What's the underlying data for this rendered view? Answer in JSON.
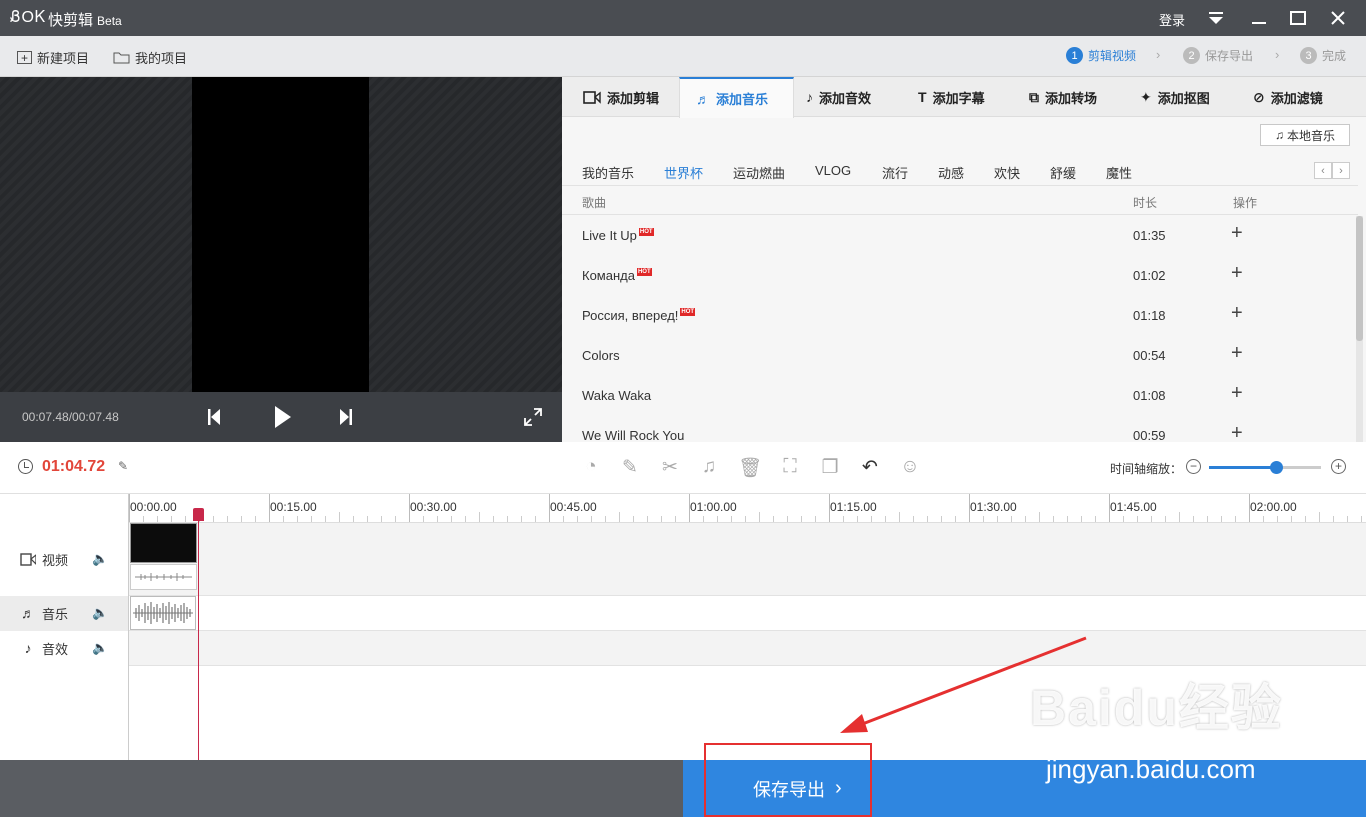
{
  "app": {
    "logo": "ᏰOᏦ",
    "name": "快剪辑",
    "edition": "Beta"
  },
  "titlebar": {
    "login": "登录"
  },
  "toolbar": {
    "new_project": "新建项目",
    "my_projects": "我的项目",
    "steps": [
      {
        "num": "1",
        "label": "剪辑视频"
      },
      {
        "num": "2",
        "label": "保存导出"
      },
      {
        "num": "3",
        "label": "完成"
      }
    ]
  },
  "player": {
    "time": "00:07.48/00:07.48"
  },
  "tabs": [
    {
      "label": "添加剪辑",
      "icon": "video-camera-icon"
    },
    {
      "label": "添加音乐",
      "icon": "music-note-icon"
    },
    {
      "label": "添加音效",
      "icon": "sound-effect-icon"
    },
    {
      "label": "添加字幕",
      "icon": "text-icon"
    },
    {
      "label": "添加转场",
      "icon": "transition-icon"
    },
    {
      "label": "添加抠图",
      "icon": "cutout-icon"
    },
    {
      "label": "添加滤镜",
      "icon": "filter-icon"
    }
  ],
  "music": {
    "local_music": "本地音乐",
    "categories": [
      "我的音乐",
      "世界杯",
      "运动燃曲",
      "VLOG",
      "流行",
      "动感",
      "欢快",
      "舒缓",
      "魔性"
    ],
    "active_category": "世界杯",
    "columns": {
      "song": "歌曲",
      "duration": "时长",
      "action": "操作"
    },
    "songs": [
      {
        "name": "Live It Up",
        "hot": "HOT",
        "duration": "01:35"
      },
      {
        "name": "Команда",
        "hot": "HOT",
        "duration": "01:02"
      },
      {
        "name": "Россия, вперед!",
        "hot": "HOT",
        "duration": "01:18"
      },
      {
        "name": "Colors",
        "hot": "",
        "duration": "00:54"
      },
      {
        "name": "Waka Waka",
        "hot": "",
        "duration": "01:08"
      },
      {
        "name": "We Will Rock You",
        "hot": "",
        "duration": "00:59"
      }
    ]
  },
  "edit": {
    "current_time": "01:04.72",
    "zoom_label": "时间轴缩放：",
    "zoom_level": 0.6
  },
  "timeline": {
    "ticks": [
      "00:00.00",
      "00:15.00",
      "00:30.00",
      "00:45.00",
      "01:00.00",
      "01:15.00",
      "01:30.00",
      "01:45.00",
      "02:00.00"
    ],
    "tracks": [
      {
        "label": "视频",
        "icon": "video-camera-icon"
      },
      {
        "label": "音乐",
        "icon": "music-note-icon"
      },
      {
        "label": "音效",
        "icon": "sound-effect-icon"
      }
    ]
  },
  "footer": {
    "save_export": "保存导出"
  },
  "watermark": {
    "logo": "Baidu经验",
    "url": "jingyan.baidu.com"
  },
  "colors": {
    "accent": "#2f86e0",
    "time": "#e2463a",
    "playhead": "#c8284a"
  }
}
